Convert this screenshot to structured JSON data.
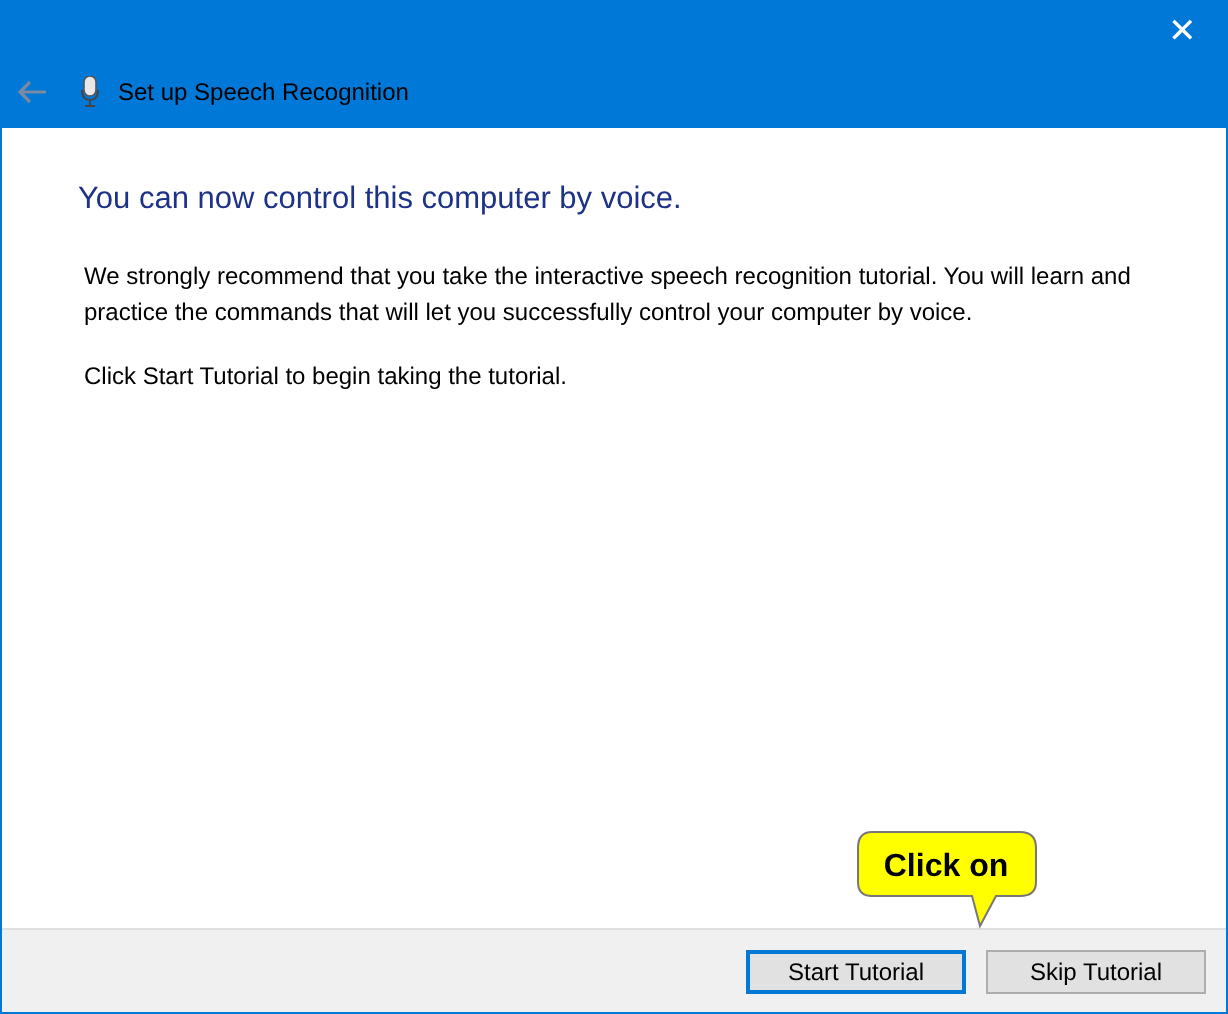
{
  "window": {
    "title": "Set up Speech Recognition",
    "close": "✕"
  },
  "heading": "You can now control this computer by voice.",
  "paragraphs": [
    "We strongly recommend that you take the interactive speech recognition tutorial. You will learn and practice the commands that will let you successfully control your computer by voice.",
    "Click Start Tutorial to begin taking the tutorial."
  ],
  "callout": {
    "text": "Click on"
  },
  "buttons": [
    {
      "label": "Start Tutorial",
      "default": true
    },
    {
      "label": "Skip Tutorial",
      "default": false
    }
  ]
}
